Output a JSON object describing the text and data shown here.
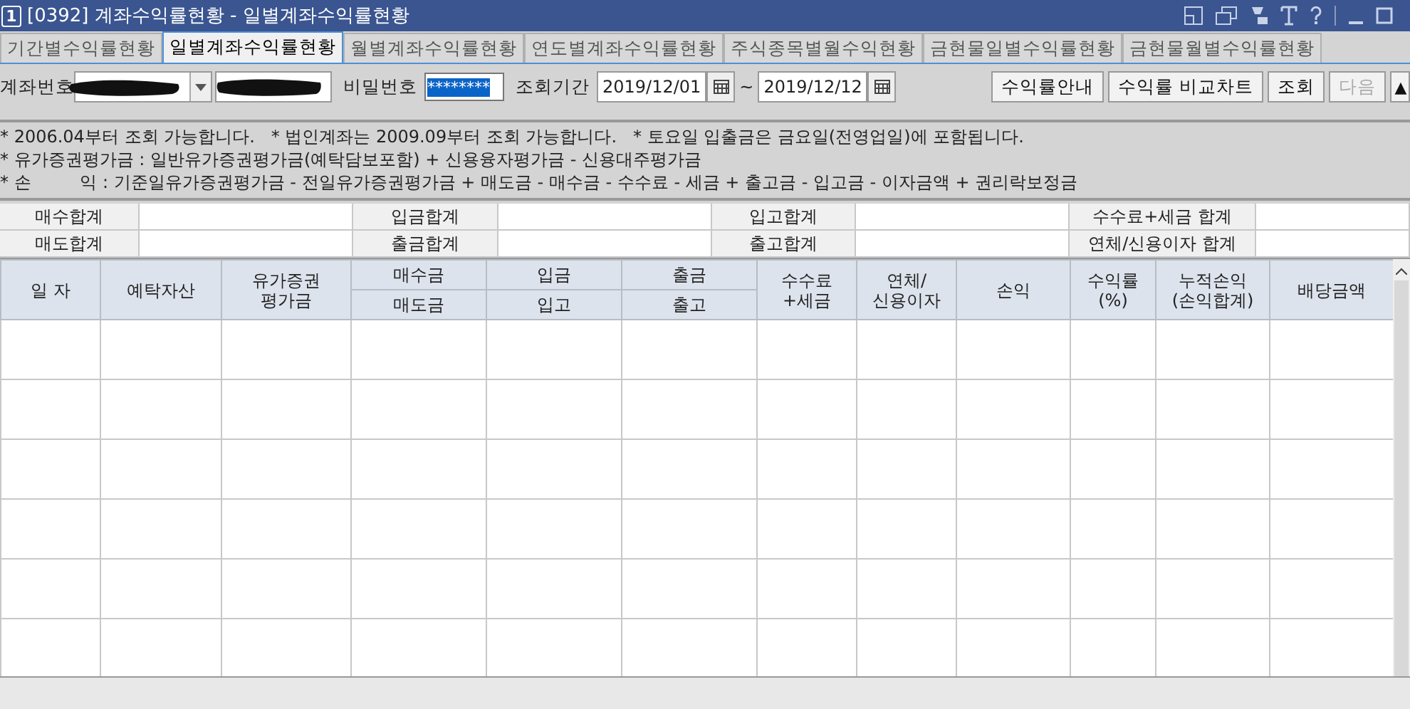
{
  "window": {
    "number": "1",
    "title": "[0392] 계좌수익률현황 - 일별계좌수익률현황"
  },
  "tabs": [
    {
      "label": "기간별수익률현황",
      "selected": false
    },
    {
      "label": "일별계좌수익률현황",
      "selected": true
    },
    {
      "label": "월별계좌수익률현황",
      "selected": false
    },
    {
      "label": "연도별계좌수익률현황",
      "selected": false
    },
    {
      "label": "주식종목별월수익현황",
      "selected": false
    },
    {
      "label": "금현물일별수익률현황",
      "selected": false
    },
    {
      "label": "금현물월별수익률현황",
      "selected": false
    }
  ],
  "query": {
    "account_label": "계좌번호",
    "password_label": "비밀번호",
    "password": "********",
    "period_label": "조회기간",
    "start_date": "2019/12/01",
    "separator": "~",
    "end_date": "2019/12/12",
    "buttons": [
      {
        "label": "수익률안내",
        "disabled": false
      },
      {
        "label": "수익률 비교차트",
        "disabled": false
      },
      {
        "label": "조회",
        "disabled": false
      },
      {
        "label": "다음",
        "disabled": true
      }
    ],
    "collapse_button": "▲"
  },
  "notes": [
    "* 2006.04부터 조회 가능합니다.   * 법인계좌는 2009.09부터 조회 가능합니다.   * 토요일 입출금은 금요일(전영업일)에 포함됩니다.",
    "* 유가증권평가금 : 일반유가증권평가금(예탁담보포함) + 신용융자평가금 - 신용대주평가금",
    "* 손         익 : 기준일유가증권평가금 - 전일유가증권평가금 + 매도금 - 매수금 - 수수료 - 세금 + 출고금 - 입고금 - 이자금액 + 권리락보정금"
  ],
  "summary": [
    [
      "매수합계",
      "입금합계",
      "입고합계",
      "수수료+세금 합계"
    ],
    [
      "매도합계",
      "출금합계",
      "출고합계",
      "연체/신용이자 합계"
    ]
  ],
  "table": {
    "columns": [
      {
        "top": "일 자"
      },
      {
        "top": "예탁자산"
      },
      {
        "top": "유가증권\n평가금"
      },
      {
        "top": "매수금",
        "bottom": "매도금"
      },
      {
        "top": "입금",
        "bottom": "입고"
      },
      {
        "top": "출금",
        "bottom": "출고"
      },
      {
        "top": "수수료\n+세금"
      },
      {
        "top": "연체/\n신용이자"
      },
      {
        "top": "손익"
      },
      {
        "top": "수익률\n(%)"
      },
      {
        "top": "누적손익\n(손익합계)"
      },
      {
        "top": "배당금액"
      }
    ]
  }
}
